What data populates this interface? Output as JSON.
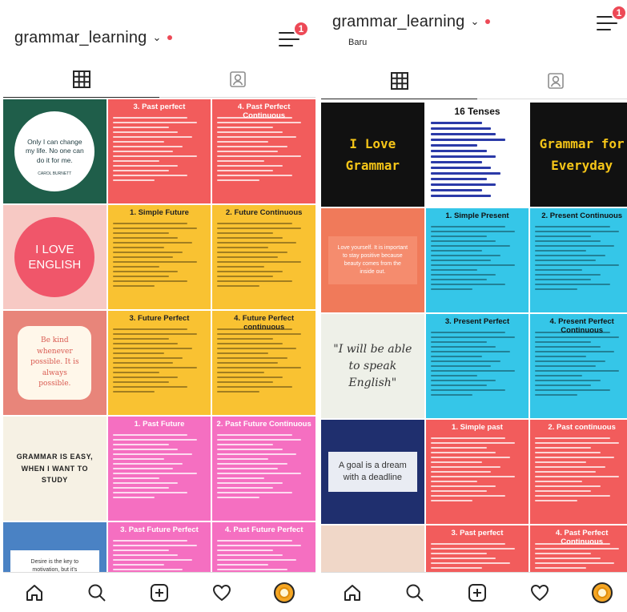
{
  "left": {
    "username": "grammar_learning",
    "notification_count": "1",
    "tiles": [
      {
        "kind": "quote-circle",
        "text": "Only I can change my life. No one can do it for me.",
        "sub": "CAROL BURNETT",
        "bg": "#1f5e4a"
      },
      {
        "kind": "note",
        "title": "3. Past perfect",
        "bg": "#f25c5c",
        "hdr": "#ffffff"
      },
      {
        "kind": "note",
        "title": "4. Past Perfect Continuous",
        "bg": "#f25c5c",
        "hdr": "#ffffff"
      },
      {
        "kind": "quote-circle",
        "text": "I LOVE ENGLISH",
        "sub": "",
        "bg": "#f7c9c4"
      },
      {
        "kind": "note",
        "title": "1. Simple Future",
        "bg": "#f9c232",
        "hdr": "#222222"
      },
      {
        "kind": "note",
        "title": "2. Future Continuous",
        "bg": "#f9c232",
        "hdr": "#222222"
      },
      {
        "kind": "quote-badge",
        "text": "Be kind whenever possible. It is always possible.",
        "bg": "#e8857a"
      },
      {
        "kind": "note",
        "title": "3. Future Perfect",
        "bg": "#f9c232",
        "hdr": "#222222"
      },
      {
        "kind": "note",
        "title": "4. Future Perfect continuous",
        "bg": "#f9c232",
        "hdr": "#222222"
      },
      {
        "kind": "quote-plain",
        "text": "GRAMMAR IS EASY, WHEN I WANT TO STUDY",
        "bg": "#f6f1e4"
      },
      {
        "kind": "note",
        "title": "1. Past Future",
        "bg": "#f56fc1",
        "hdr": "#ffffff"
      },
      {
        "kind": "note",
        "title": "2. Past Future Continuous",
        "bg": "#f56fc1",
        "hdr": "#ffffff"
      },
      {
        "kind": "quote-box",
        "text": "Desire is the key to motivation, but it's determination and commitment",
        "bg": "#4a82c4"
      },
      {
        "kind": "note",
        "title": "3. Past Future Perfect",
        "bg": "#f56fc1",
        "hdr": "#ffffff"
      },
      {
        "kind": "note",
        "title": "4. Past Future Perfect",
        "bg": "#f56fc1",
        "hdr": "#ffffff"
      }
    ]
  },
  "right": {
    "username": "grammar_learning",
    "notification_count": "1",
    "baru_label": "Baru",
    "tiles": [
      {
        "kind": "quote-dark",
        "text": "I Love Grammar",
        "bg": "#111111"
      },
      {
        "kind": "list",
        "title": "16 Tenses",
        "bg": "#ffffff"
      },
      {
        "kind": "quote-dark",
        "text": "Grammar for Everyday",
        "bg": "#111111"
      },
      {
        "kind": "quote-box",
        "text": "Love yourself. It is important to stay positive because beauty comes from the inside out.",
        "bg": "#f07a5a"
      },
      {
        "kind": "note",
        "title": "1. Simple Present",
        "bg": "#35c6e8",
        "hdr": "#111111"
      },
      {
        "kind": "note",
        "title": "2. Present Continuous",
        "bg": "#35c6e8",
        "hdr": "#111111"
      },
      {
        "kind": "quote-script",
        "text": "\"I will be able to speak English\"",
        "bg": "#eef0e8"
      },
      {
        "kind": "note",
        "title": "3. Present Perfect",
        "bg": "#35c6e8",
        "hdr": "#111111"
      },
      {
        "kind": "note",
        "title": "4. Present Perfect Continuous",
        "bg": "#35c6e8",
        "hdr": "#111111"
      },
      {
        "kind": "quote-box",
        "text": "A goal is a dream with a deadline",
        "bg": "#1f2f6e"
      },
      {
        "kind": "note",
        "title": "1. Simple past",
        "bg": "#f25c5c",
        "hdr": "#ffffff"
      },
      {
        "kind": "note",
        "title": "2. Past continuous",
        "bg": "#f25c5c",
        "hdr": "#ffffff"
      },
      {
        "kind": "quote-plain",
        "text": "",
        "bg": "#f0d7c8"
      },
      {
        "kind": "note",
        "title": "3. Past perfect",
        "bg": "#f25c5c",
        "hdr": "#ffffff"
      },
      {
        "kind": "note",
        "title": "4. Past Perfect Continuous",
        "bg": "#f25c5c",
        "hdr": "#ffffff"
      }
    ]
  },
  "colors": {
    "text": "#262626",
    "notify": "#ed4956",
    "divider": "#dbdbdb"
  },
  "icons": [
    "grid-icon",
    "tagged-icon",
    "home-icon",
    "search-icon",
    "add-post-icon",
    "heart-icon",
    "profile-avatar-icon",
    "menu-icon"
  ]
}
